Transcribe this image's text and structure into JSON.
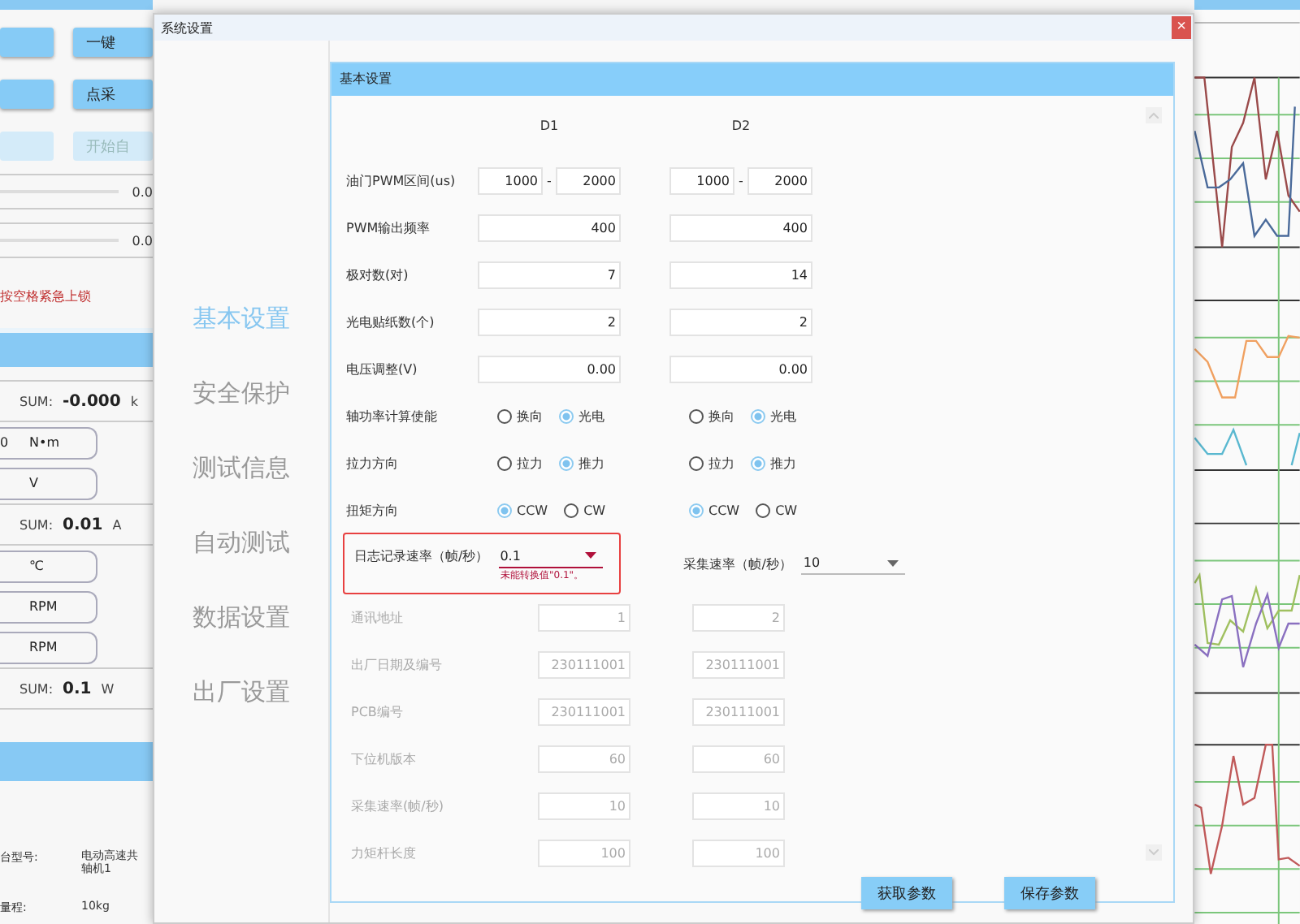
{
  "background_app": {
    "buttons": [
      {
        "label": "一键",
        "disabled": false
      },
      {
        "label": "点采",
        "disabled": false
      },
      {
        "label": "开始自",
        "disabled": true
      }
    ],
    "sliders": [
      {
        "reading": "0.0"
      },
      {
        "reading": "0.0"
      }
    ],
    "warning": "按空格紧急上锁",
    "readings": [
      {
        "kind": "sum",
        "label": "SUM:",
        "value": "-0.000",
        "unit": "k"
      },
      {
        "kind": "unit",
        "value": "0",
        "unit": "N•m"
      },
      {
        "kind": "unit",
        "unit": "V"
      },
      {
        "kind": "sum",
        "label": "SUM:",
        "value": "0.01",
        "unit": "A"
      },
      {
        "kind": "unit",
        "unit": "℃"
      },
      {
        "kind": "unit",
        "unit": "RPM"
      },
      {
        "kind": "unit",
        "unit": "RPM"
      },
      {
        "kind": "sum",
        "label": "SUM:",
        "value": "0.1",
        "unit": "W"
      }
    ],
    "info": [
      {
        "label": "台型号:",
        "value": "电动高速共轴机1"
      },
      {
        "label": "量程:",
        "value": "10kg"
      }
    ]
  },
  "dialog": {
    "title": "系统设置",
    "close": "×",
    "nav": [
      {
        "label": "基本设置",
        "selected": true
      },
      {
        "label": "安全保护",
        "selected": false
      },
      {
        "label": "测试信息",
        "selected": false
      },
      {
        "label": "自动测试",
        "selected": false
      },
      {
        "label": "数据设置",
        "selected": false
      },
      {
        "label": "出厂设置",
        "selected": false
      }
    ],
    "panel": {
      "title": "基本设置",
      "columns": [
        "D1",
        "D2"
      ],
      "rows": [
        {
          "kind": "range",
          "label": "油门PWM区间(us)",
          "values": [
            {
              "from": "1000",
              "separator": "-",
              "to": "2000"
            },
            {
              "from": "1000",
              "separator": "-",
              "to": "2000"
            }
          ]
        },
        {
          "kind": "field",
          "label": "PWM输出频率",
          "values": [
            "400",
            "400"
          ]
        },
        {
          "kind": "field",
          "label": "极对数(对)",
          "values": [
            "7",
            "14"
          ]
        },
        {
          "kind": "field",
          "label": "光电贴纸数(个)",
          "values": [
            "2",
            "2"
          ]
        },
        {
          "kind": "field",
          "label": "电压调整(V)",
          "values": [
            "0.00",
            "0.00"
          ]
        },
        {
          "kind": "radio",
          "label": "轴功率计算使能",
          "groups": [
            [
              {
                "label": "换向",
                "selected": false
              },
              {
                "label": "光电",
                "selected": true
              }
            ],
            [
              {
                "label": "换向",
                "selected": false
              },
              {
                "label": "光电",
                "selected": true
              }
            ]
          ]
        },
        {
          "kind": "radio",
          "label": "拉力方向",
          "groups": [
            [
              {
                "label": "拉力",
                "selected": false
              },
              {
                "label": "推力",
                "selected": true
              }
            ],
            [
              {
                "label": "拉力",
                "selected": false
              },
              {
                "label": "推力",
                "selected": true
              }
            ]
          ]
        },
        {
          "kind": "radio",
          "label": "扭矩方向",
          "groups": [
            [
              {
                "label": "CCW",
                "selected": true
              },
              {
                "label": "CW",
                "selected": false
              }
            ],
            [
              {
                "label": "CCW",
                "selected": true
              },
              {
                "label": "CW",
                "selected": false
              }
            ]
          ]
        },
        {
          "kind": "combo",
          "items": [
            {
              "label": "日志记录速率（帧/秒）",
              "value": "0.1",
              "invalid": true,
              "error": "未能转换值\"0.1\"。"
            },
            {
              "label": "采集速率（帧/秒）",
              "value": "10",
              "invalid": false
            }
          ]
        },
        {
          "kind": "readonly",
          "label": "通讯地址",
          "values": [
            "1",
            "2"
          ],
          "disabled": true
        },
        {
          "kind": "readonly",
          "label": "出厂日期及编号",
          "values": [
            "230111001",
            "230111001"
          ],
          "disabled": true
        },
        {
          "kind": "readonly",
          "label": "PCB编号",
          "values": [
            "230111001",
            "230111001"
          ],
          "disabled": true
        },
        {
          "kind": "readonly",
          "label": "下位机版本",
          "values": [
            "60",
            "60"
          ],
          "disabled": true
        },
        {
          "kind": "readonly",
          "label": "采集速率(帧/秒)",
          "values": [
            "10",
            "10"
          ],
          "disabled": true
        },
        {
          "kind": "readonly",
          "label": "力矩杆长度",
          "values": [
            "100",
            "100"
          ],
          "disabled": true
        }
      ],
      "buttons": [
        "获取参数",
        "保存参数"
      ]
    }
  }
}
